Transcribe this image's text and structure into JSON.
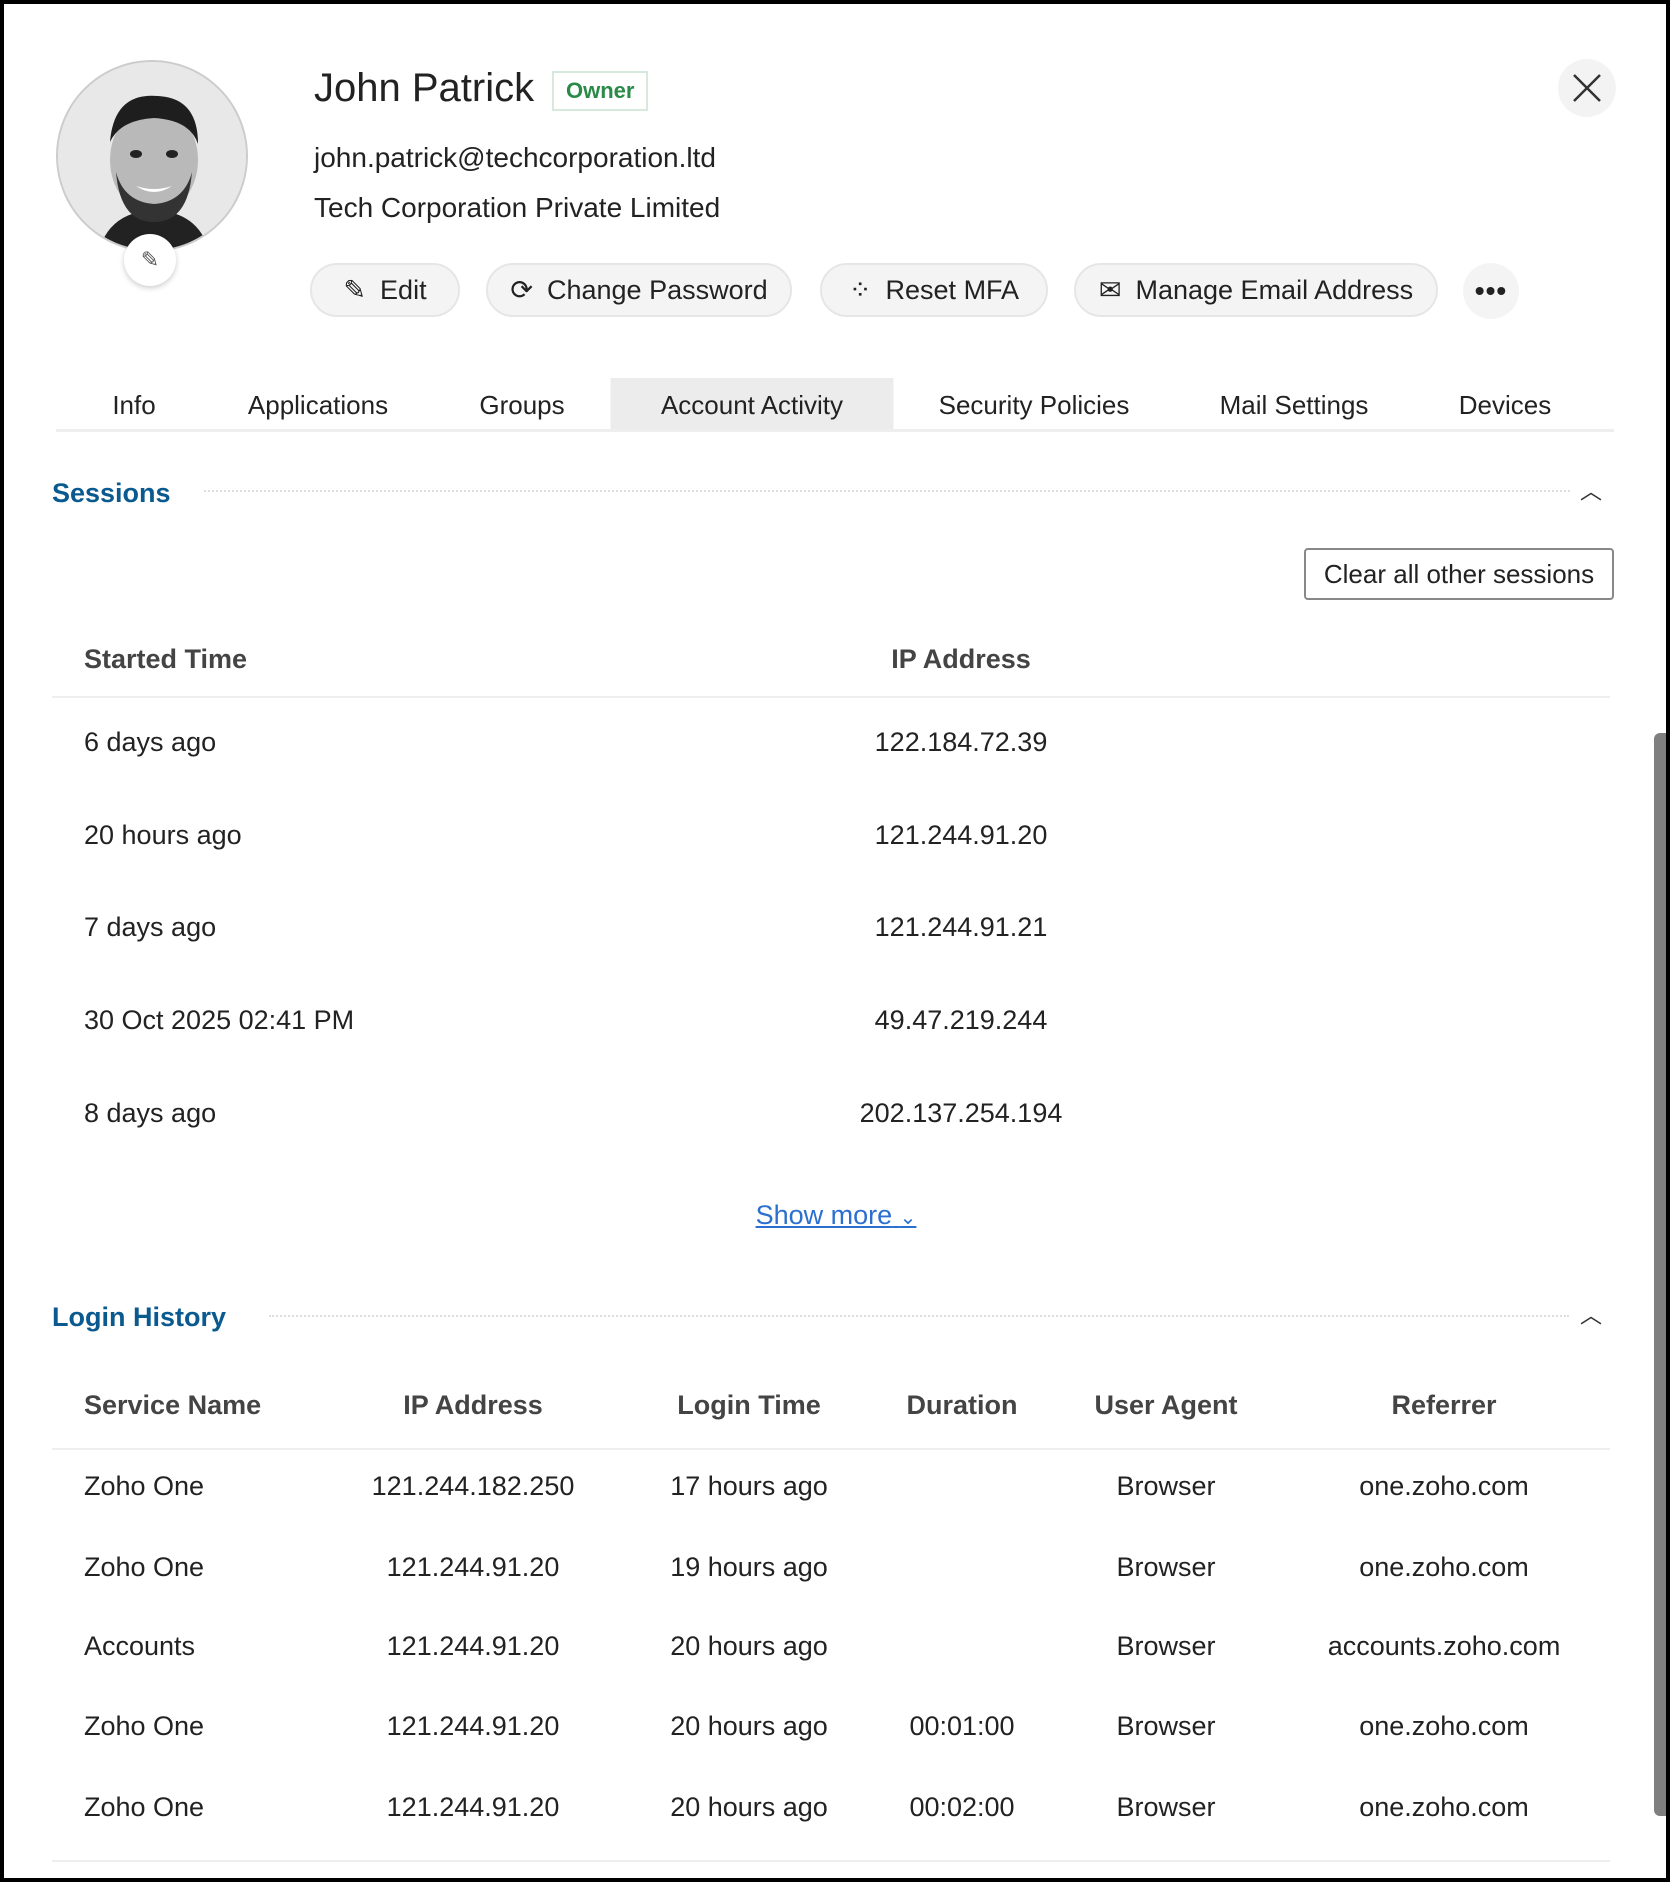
{
  "user": {
    "name": "John Patrick",
    "role_badge": "Owner",
    "email": "john.patrick@techcorporation.ltd",
    "company": "Tech Corporation Private Limited"
  },
  "actions": [
    {
      "label": "Edit",
      "icon": "pencil-icon"
    },
    {
      "label": "Change Password",
      "icon": "refresh-icon"
    },
    {
      "label": "Reset MFA",
      "icon": "mfa-icon"
    },
    {
      "label": "Manage Email Address",
      "icon": "email-settings-icon"
    }
  ],
  "more_label": "•••",
  "tabs": [
    "Info",
    "Applications",
    "Groups",
    "Account Activity",
    "Security Policies",
    "Mail Settings",
    "Devices"
  ],
  "active_tab": "Account Activity",
  "sessions": {
    "title": "Sessions",
    "clear_label": "Clear all other sessions",
    "headers": [
      "Started Time",
      "IP Address"
    ],
    "rows": [
      [
        "6 days ago",
        "122.184.72.39"
      ],
      [
        "20 hours ago",
        "121.244.91.20"
      ],
      [
        "7 days ago",
        "121.244.91.21"
      ],
      [
        "30 Oct 2025 02:41 PM",
        "49.47.219.244"
      ],
      [
        "8 days ago",
        "202.137.254.194"
      ]
    ],
    "show_more": "Show more"
  },
  "login_history": {
    "title": "Login History",
    "headers": [
      "Service Name",
      "IP Address",
      "Login Time",
      "Duration",
      "User Agent",
      "Referrer"
    ],
    "rows": [
      [
        "Zoho One",
        "121.244.182.250",
        "17 hours ago",
        "",
        "Browser",
        "one.zoho.com"
      ],
      [
        "Zoho One",
        "121.244.91.20",
        "19 hours ago",
        "",
        "Browser",
        "one.zoho.com"
      ],
      [
        "Accounts",
        "121.244.91.20",
        "20 hours ago",
        "",
        "Browser",
        "accounts.zoho.com"
      ],
      [
        "Zoho One",
        "121.244.91.20",
        "20 hours ago",
        "00:01:00",
        "Browser",
        "one.zoho.com"
      ],
      [
        "Zoho One",
        "121.244.91.20",
        "20 hours ago",
        "00:02:00",
        "Browser",
        "one.zoho.com"
      ]
    ]
  },
  "colors": {
    "accent": "#0b5a8f",
    "link": "#2b6fd0",
    "badge": "#2a8a48"
  }
}
